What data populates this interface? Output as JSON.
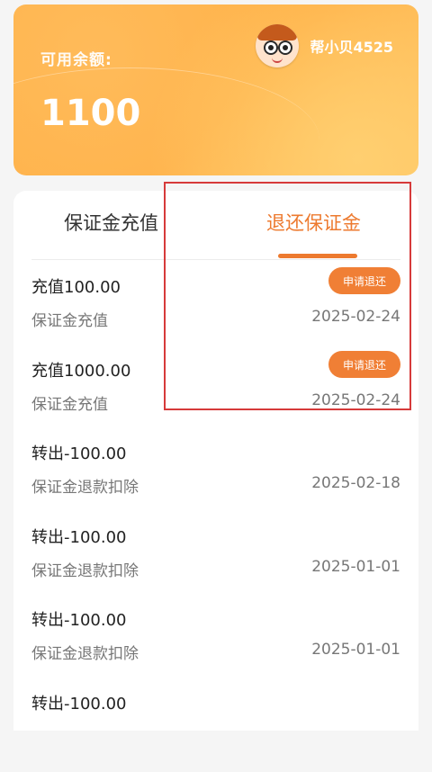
{
  "balance": {
    "label": "可用余额:",
    "amount": "1100",
    "username": "帮小贝4525"
  },
  "tabs": [
    {
      "label": "保证金充值",
      "active": false
    },
    {
      "label": "退还保证金",
      "active": true
    }
  ],
  "colors": {
    "accent": "#ed7a2f",
    "card_gradient": "#ffb24a",
    "highlight": "#d63a3a"
  },
  "records": [
    {
      "title": "充值100.00",
      "type": "保证金充值",
      "date": "2025-02-24",
      "action": "申请退还"
    },
    {
      "title": "充值1000.00",
      "type": "保证金充值",
      "date": "2025-02-24",
      "action": "申请退还"
    },
    {
      "title": "转出-100.00",
      "type": "保证金退款扣除",
      "date": "2025-02-18"
    },
    {
      "title": "转出-100.00",
      "type": "保证金退款扣除",
      "date": "2025-01-01"
    },
    {
      "title": "转出-100.00",
      "type": "保证金退款扣除",
      "date": "2025-01-01"
    },
    {
      "title": "转出-100.00"
    }
  ]
}
